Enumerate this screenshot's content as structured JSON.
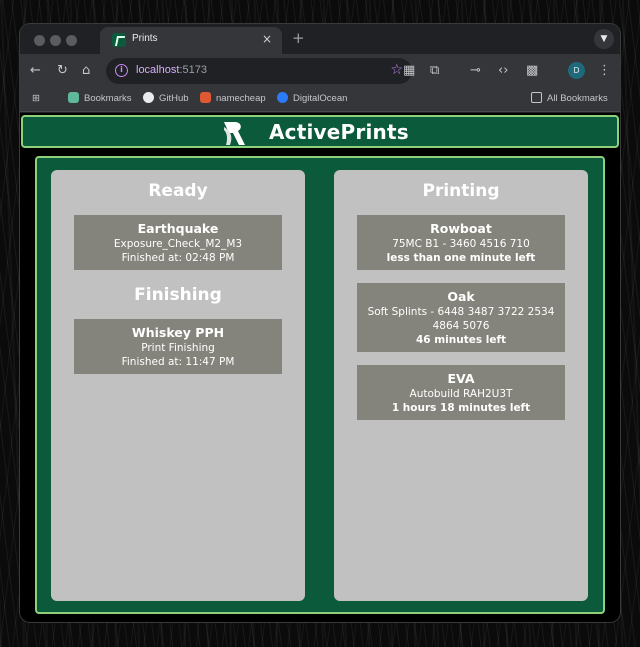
{
  "browser": {
    "tab_title": "Prints",
    "tab_close": "×",
    "new_tab": "+",
    "url_host": "localhost",
    "url_port": ":5173",
    "profile_initial": "D",
    "bookmarks": [
      {
        "label": "Bookmarks",
        "icon": "star-icon",
        "color": "#5fb89a"
      },
      {
        "label": "GitHub",
        "icon": "github-icon",
        "color": "#e8eaed"
      },
      {
        "label": "namecheap",
        "icon": "namecheap-icon",
        "color": "#de5833"
      },
      {
        "label": "DigitalOcean",
        "icon": "digitalocean-icon",
        "color": "#2b7bf5"
      }
    ],
    "all_bookmarks": "All Bookmarks"
  },
  "app": {
    "title": "ActivePrints",
    "brand_color": "#0a5a3b",
    "border_color": "#8fd17a"
  },
  "ready": {
    "title": "Ready",
    "cards": [
      {
        "name": "Earthquake",
        "line1": "Exposure_Check_M2_M3",
        "line2": "Finished at: 02:48 PM"
      }
    ]
  },
  "finishing": {
    "title": "Finishing",
    "cards": [
      {
        "name": "Whiskey PPH",
        "line1": "Print Finishing",
        "line2": "Finished at: 11:47 PM"
      }
    ]
  },
  "printing": {
    "title": "Printing",
    "cards": [
      {
        "name": "Rowboat",
        "line1": "75MC B1 - 3460 4516 710",
        "line2": "less than one minute left"
      },
      {
        "name": "Oak",
        "line1": "Soft Splints - 6448 3487 3722 2534 4864 5076",
        "line2": "46 minutes left"
      },
      {
        "name": "EVA",
        "line1": "Autobuild RAH2U3T",
        "line2": "1 hours 18 minutes left"
      }
    ]
  }
}
